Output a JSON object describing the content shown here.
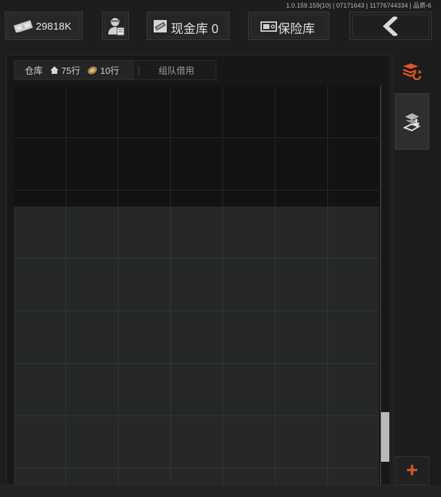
{
  "version_text": "1.0.159.159(10) | 07171643 | 11776744334 | 品质-6",
  "header": {
    "money": "29818K",
    "cash_label": "现金库 0",
    "safe_label": "保险库"
  },
  "tabs": {
    "warehouse_label": "仓库",
    "warehouse_rows": "75行",
    "extra_rows": "10行",
    "team_label": "组队借用"
  },
  "colors": {
    "accent": "#e0552b",
    "background": "#1c1d1d",
    "grid_dark": "#121313",
    "grid_light": "#262828"
  },
  "icons": [
    "money-icon",
    "agent-icon",
    "cash-icon",
    "safe-icon",
    "back-arrow-icon",
    "home-icon",
    "money-roll-icon",
    "layers-refresh-icon",
    "layers-download-icon",
    "plus-icon"
  ],
  "scrollbar": {
    "position_fraction": 0.95
  }
}
